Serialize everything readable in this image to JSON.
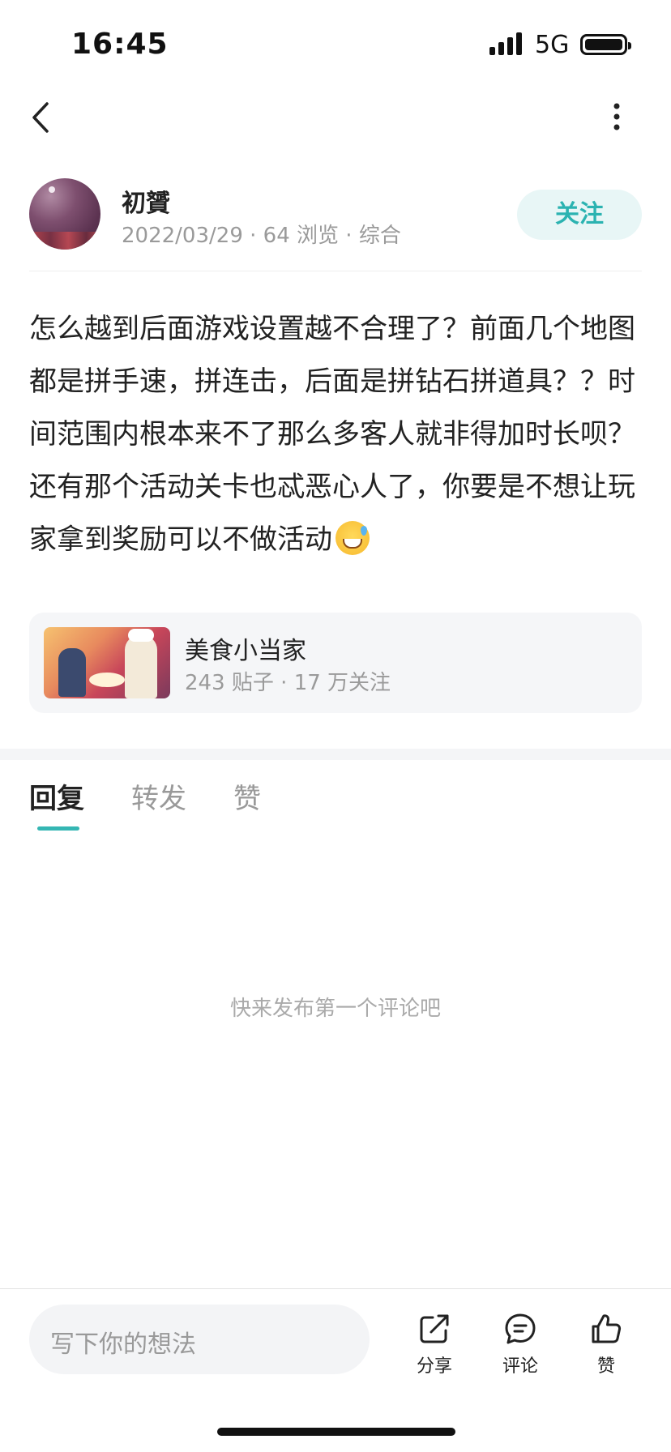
{
  "status_bar": {
    "time": "16:45",
    "network": "5G"
  },
  "author": {
    "name": "初贇",
    "date": "2022/03/29",
    "views": "64 浏览",
    "category": "综合",
    "follow_label": "关注"
  },
  "post": {
    "text": "怎么越到后面游戏设置越不合理了？前面几个地图都是拼手速，拼连击，后面是拼钻石拼道具？？时间范围内根本来不了那么多客人就非得加时长呗？还有那个活动关卡也忒恶心人了，你要是不想让玩家拿到奖励可以不做活动"
  },
  "game_card": {
    "title": "美食小当家",
    "posts": "243 贴子",
    "followers": "17 万关注"
  },
  "tabs": [
    {
      "label": "回复"
    },
    {
      "label": "转发"
    },
    {
      "label": "赞"
    }
  ],
  "empty_text": "快来发布第一个评论吧",
  "bottom_bar": {
    "input_placeholder": "写下你的想法",
    "share_label": "分享",
    "comment_label": "评论",
    "like_label": "赞"
  },
  "colors": {
    "accent": "#34b6b3",
    "follow_bg": "#e8f6f6"
  },
  "icons": {
    "back": "chevron-left-icon",
    "more": "more-vertical-icon",
    "share": "share-icon",
    "comment": "comment-icon",
    "like": "thumbs-up-icon",
    "emoji": "grinning-sweat-emoji"
  }
}
